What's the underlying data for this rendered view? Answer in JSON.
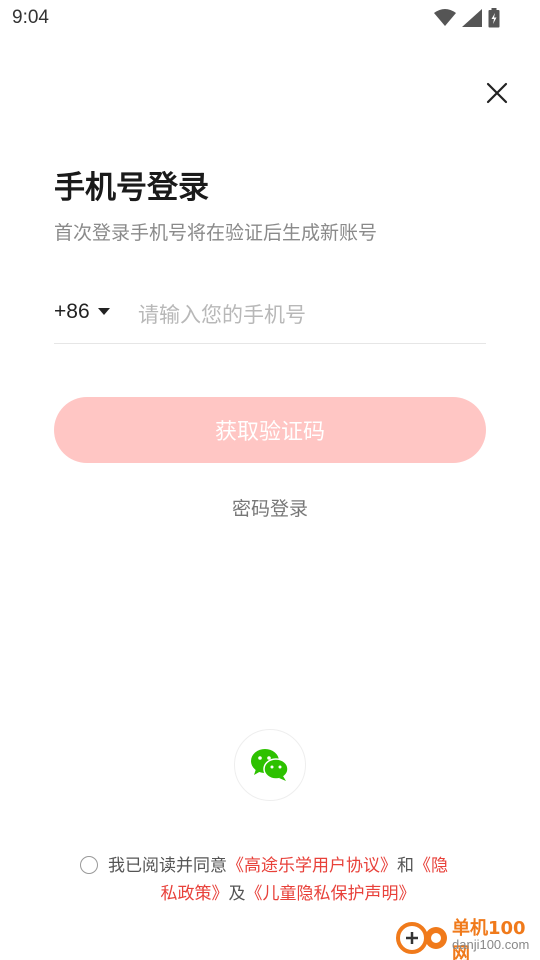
{
  "status_bar": {
    "time": "9:04"
  },
  "login": {
    "title": "手机号登录",
    "subtitle": "首次登录手机号将在验证后生成新账号",
    "country_code": "+86",
    "phone_placeholder": "请输入您的手机号",
    "phone_value": "",
    "get_code_label": "获取验证码",
    "password_login_label": "密码登录"
  },
  "agreement": {
    "prefix": "我已阅读并同意",
    "user_agreement": "《高途乐学用户协议》",
    "and": "和",
    "privacy_part1": "《隐",
    "privacy_part2": "私政策》",
    "and2": "及",
    "children_privacy": "《儿童隐私保护声明》"
  },
  "watermark": {
    "name": "单机100网",
    "url": "danji100.com"
  },
  "icons": {
    "close": "close-icon",
    "dropdown": "caret-down-icon",
    "wechat": "wechat-icon",
    "wifi": "wifi-icon",
    "signal": "signal-icon",
    "battery": "battery-icon"
  },
  "colors": {
    "accent": "#e8413a",
    "button_disabled": "#ffc6c4",
    "wechat_green": "#2dc100"
  }
}
